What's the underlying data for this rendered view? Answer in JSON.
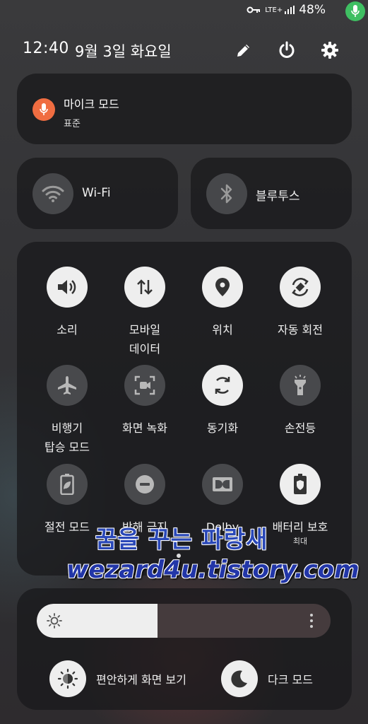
{
  "status_bar": {
    "network": "LTE+",
    "battery": "48%"
  },
  "header": {
    "time": "12:40",
    "date": "9월 3일 화요일"
  },
  "mic_mode": {
    "title": "마이크 모드",
    "subtitle": "표준",
    "accent_color": "#f06d41"
  },
  "connectivity": [
    {
      "label": "Wi-Fi",
      "icon": "wifi-icon"
    },
    {
      "label": "블루투스",
      "icon": "bluetooth-icon"
    }
  ],
  "quick_tiles": [
    {
      "label1": "소리",
      "label2": "",
      "icon": "volume-icon",
      "state": "on"
    },
    {
      "label1": "모바일",
      "label2": "데이터",
      "icon": "data-arrows-icon",
      "state": "on"
    },
    {
      "label1": "위치",
      "label2": "",
      "icon": "location-pin-icon",
      "state": "on"
    },
    {
      "label1": "자동 회전",
      "label2": "",
      "icon": "auto-rotate-icon",
      "state": "on"
    },
    {
      "label1": "비행기",
      "label2": "탑승 모드",
      "icon": "airplane-icon",
      "state": "off"
    },
    {
      "label1": "화면 녹화",
      "label2": "",
      "icon": "screen-record-icon",
      "state": "off"
    },
    {
      "label1": "동기화",
      "label2": "",
      "icon": "sync-icon",
      "state": "on"
    },
    {
      "label1": "손전등",
      "label2": "",
      "icon": "flashlight-icon",
      "state": "off"
    },
    {
      "label1": "절전 모드",
      "label2": "",
      "icon": "power-saving-icon",
      "state": "off"
    },
    {
      "label1": "방해 금지",
      "label2": "",
      "icon": "do-not-disturb-icon",
      "state": "off"
    },
    {
      "label1": "Dolby",
      "label2": "",
      "icon": "dolby-icon",
      "state": "off"
    },
    {
      "label1": "배터리 보호",
      "label2": "최대",
      "icon": "battery-shield-icon",
      "state": "on"
    }
  ],
  "brightness": {
    "level_percent": 41
  },
  "bottom_buttons": [
    {
      "label": "편안하게 화면 보기",
      "icon": "eye-comfort-icon"
    },
    {
      "label": "다크 모드",
      "icon": "moon-icon"
    }
  ],
  "watermark": {
    "line1": "꿈을 꾸는 파랑새",
    "line2": "wezard4u.tistory.com"
  }
}
